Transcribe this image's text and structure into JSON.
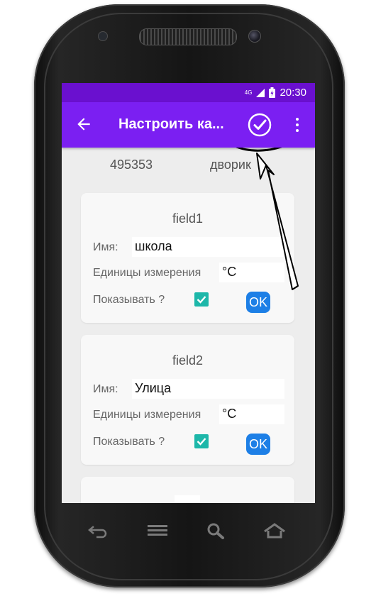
{
  "status": {
    "network": "4G",
    "time": "20:30"
  },
  "appbar": {
    "title": "Настроить ка..."
  },
  "header": {
    "id": "495353",
    "name": "дворик"
  },
  "fields": [
    {
      "title": "field1",
      "name_label": "Имя:",
      "name_value": "школа",
      "unit_label": "Единицы измерения",
      "unit_value": "°C",
      "show_label": "Показывать ?",
      "show_checked": true,
      "ok_label": "OK"
    },
    {
      "title": "field2",
      "name_label": "Имя:",
      "name_value": "Улица",
      "unit_label": "Единицы измерения",
      "unit_value": "°C",
      "show_label": "Показывать ?",
      "show_checked": true,
      "ok_label": "OK"
    }
  ],
  "icons": {
    "back": "arrow-back-icon",
    "confirm": "check-circle-icon",
    "menu": "more-vert-icon",
    "nav_back": "back-icon",
    "nav_menu": "menu-icon",
    "nav_search": "search-icon",
    "nav_home": "home-icon"
  },
  "colors": {
    "appbar": "#7b1ff2",
    "statusbar": "#6a10cf",
    "checkbox": "#1db7a9",
    "ok_button": "#1d7fe6"
  }
}
